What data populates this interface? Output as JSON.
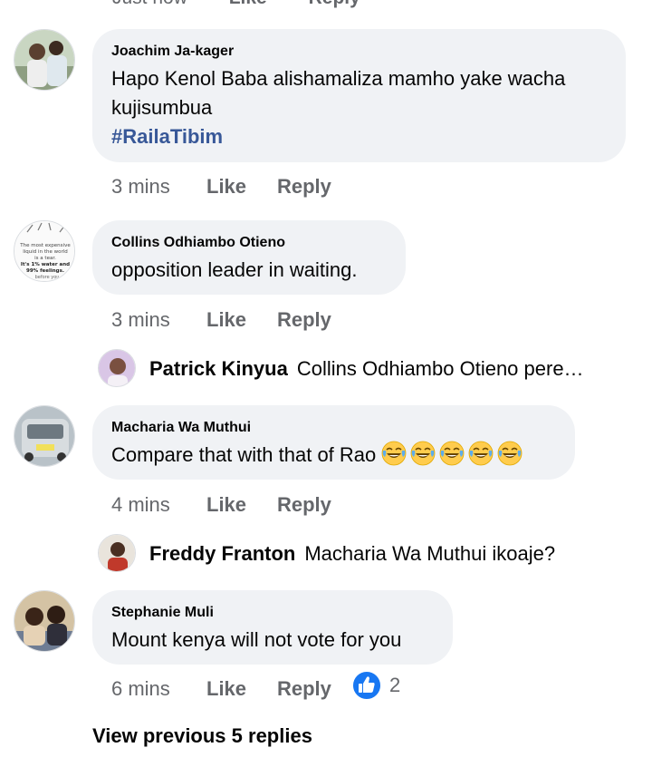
{
  "top_meta": {
    "time": "Just now",
    "like": "Like",
    "reply": "Reply"
  },
  "comments": [
    {
      "author": "Joachim Ja-kager",
      "text": "Hapo Kenol Baba alishamaliza mamho yake wacha kujisumbua",
      "hashtag": "#RailaTibim",
      "time": "3 mins",
      "like": "Like",
      "reply": "Reply"
    },
    {
      "author": "Collins Odhiambo Otieno",
      "text": "opposition leader in waiting.",
      "avatar_text": "The most expensive liquid in the world is a tear. It's 1% water and 99% feelings. before you",
      "time": "3 mins",
      "like": "Like",
      "reply": "Reply",
      "reply_preview": {
        "name": "Patrick Kinyua",
        "text": "Collins Odhiambo Otieno pere…"
      }
    },
    {
      "author": "Macharia Wa Muthui",
      "text": "Compare that with that of Rao",
      "emoji": "face-with-tears-of-joy",
      "emoji_count": 5,
      "time": "4 mins",
      "like": "Like",
      "reply": "Reply",
      "reply_preview": {
        "name": "Freddy Franton",
        "text": "Macharia Wa Muthui ikoaje?"
      }
    },
    {
      "author": "Stephanie Muli",
      "text": "Mount kenya will not vote for you",
      "time": "6 mins",
      "like": "Like",
      "reply": "Reply",
      "reaction": {
        "icon": "like-thumb-icon",
        "count": "2"
      }
    }
  ],
  "view_previous": "View previous 5 replies",
  "colors": {
    "bubble": "#f0f2f5",
    "meta": "#65676b",
    "hashtag": "#385898",
    "like_blue": "#1877f2"
  }
}
